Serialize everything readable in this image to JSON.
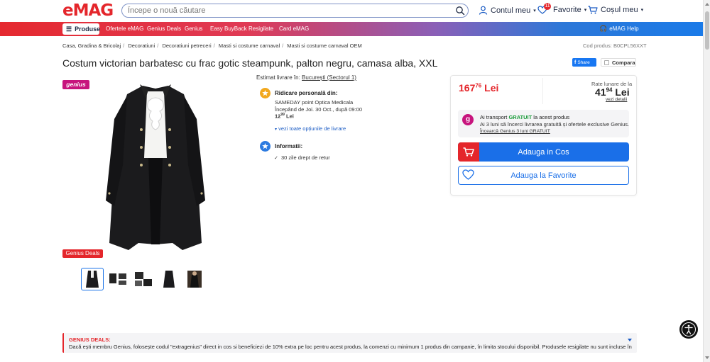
{
  "brand": {
    "logo_text": "eMAG",
    "accent": "#e4262b",
    "blue": "#1a6fe8",
    "genius_color": "#c7147d"
  },
  "header": {
    "search_placeholder": "Începe o nouă căutare",
    "account_label": "Contul meu",
    "favorites_label": "Favorite",
    "favorites_count": "11",
    "cart_label": "Coșul meu"
  },
  "nav": {
    "products_label": "Produse",
    "items": [
      "Ofertele eMAG",
      "Genius Deals",
      "Genius",
      "Easy BuyBack",
      "Resigilate",
      "Card eMAG"
    ],
    "help_label": "eMAG Help"
  },
  "breadcrumb": {
    "items": [
      "Casa, Gradina & Bricolaj",
      "Decoratiuni",
      "Decoratiuni petreceri",
      "Masti si costume carnaval",
      "Masti si costume carnaval OEM"
    ],
    "product_code": "Cod produs: B0CPL56XXT"
  },
  "product": {
    "title": "Costum victorian barbatesc cu frac gotic steampunk, palton negru, camasa alba, XXL",
    "share_label": "Share",
    "compare_label": "Compara",
    "genius_badge": "genius",
    "genius_deals_tag": "Genius Deals",
    "thumbnail_count": 5
  },
  "delivery": {
    "estimate_label": "Estimat livrare în:",
    "location": "București (Sectorul 1)",
    "pickup_title": "Ridicare personală din:",
    "pickup_point": "SAMEDAY point Optica Medicala",
    "pickup_date": "Începând de Joi. 30 Oct., după 09:00",
    "pickup_price_int": "12",
    "pickup_price_dec": "99",
    "pickup_currency": "Lei",
    "view_options": "vezi toate opțiunile de livrare",
    "info_title": "Informatii:",
    "return_policy": "30 zile drept de retur"
  },
  "buybox": {
    "price_int": "167",
    "price_dec": "76",
    "currency": "Lei",
    "rate_label": "Rate lunare de la",
    "rate_int": "41",
    "rate_dec": "94",
    "rate_currency": "Lei",
    "rate_details": "vezi detalii",
    "genius_line1_a": "Ai transport ",
    "genius_line1_free": "GRATUIT",
    "genius_line1_b": " la acest produs",
    "genius_line2": "Ai 3 luni să încerci livrarea gratuită și ofertele exclusive Genius.",
    "genius_line3": "Încearcă Genius 3 luni GRATUIT",
    "add_to_cart": "Adauga in Cos",
    "add_to_fav": "Adauga la Favorite"
  },
  "deals_banner": {
    "title": "GENIUS DEALS:",
    "text": "Dacă ești membru Genius, folosește codul \"extragenius\" direct in cos si beneficiezi de 10% extra pe loc pentru acest produs, la comenzi cu minimum 1 produs din campanie, în limita stocului disponibil. Produsele resigilate nu sunt incluse în"
  }
}
